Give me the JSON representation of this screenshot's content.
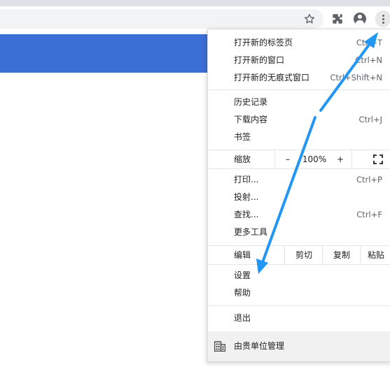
{
  "toolbar": {
    "icons": [
      "star-icon",
      "extensions-icon",
      "profile-icon",
      "more-menu-icon"
    ]
  },
  "menu": {
    "group1": [
      {
        "label": "打开新的标签页",
        "shortcut": "Ctrl+T"
      },
      {
        "label": "打开新的窗口",
        "shortcut": "Ctrl+N"
      },
      {
        "label": "打开新的无痕式窗口",
        "shortcut": "Ctrl+Shift+N"
      }
    ],
    "group2": [
      {
        "label": "历史记录",
        "shortcut": ""
      },
      {
        "label": "下载内容",
        "shortcut": "Ctrl+J"
      },
      {
        "label": "书签",
        "shortcut": ""
      }
    ],
    "zoom": {
      "label": "缩放",
      "minus": "–",
      "value": "100%",
      "plus": "+"
    },
    "group3": [
      {
        "label": "打印...",
        "shortcut": "Ctrl+P"
      },
      {
        "label": "投射...",
        "shortcut": ""
      },
      {
        "label": "查找...",
        "shortcut": "Ctrl+F"
      },
      {
        "label": "更多工具",
        "shortcut": ""
      }
    ],
    "edit": {
      "label": "编辑",
      "cut": "剪切",
      "copy": "复制",
      "paste": "粘贴"
    },
    "group4": [
      {
        "label": "设置"
      },
      {
        "label": "帮助"
      }
    ],
    "exit": "退出",
    "managed": "由贵单位管理"
  },
  "colors": {
    "accent_blue": "#3b6fd6",
    "annotation_arrow": "#2196f3"
  }
}
